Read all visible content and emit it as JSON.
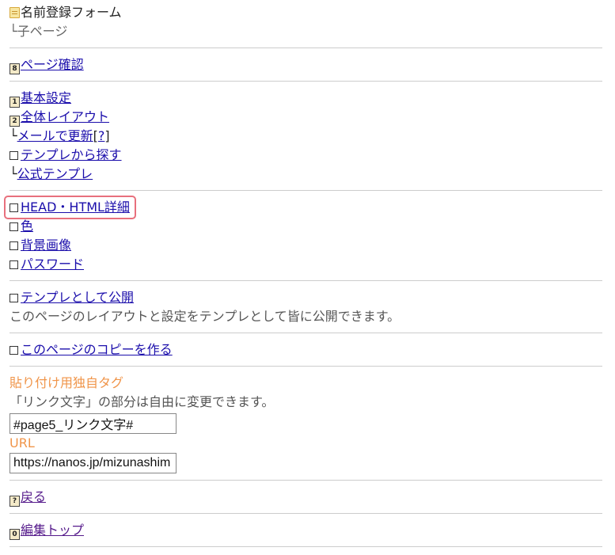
{
  "header": {
    "title": "名前登録フォーム",
    "child": "└子ページ"
  },
  "confirm": {
    "key": "8",
    "label": "ページ確認"
  },
  "settings": {
    "basic": {
      "key": "1",
      "label": "基本設定"
    },
    "layout": {
      "key": "2",
      "label": "全体レイアウト"
    },
    "mail_prefix": "└",
    "mail": "メールで更新",
    "help_open": "[",
    "help": "?",
    "help_close": "]",
    "template_search": "テンプレから探す",
    "official_prefix": "└",
    "official": "公式テンプレ"
  },
  "design": {
    "head_html": "HEAD・HTML詳細",
    "color": "色",
    "background": "背景画像",
    "password": "パスワード"
  },
  "publish": {
    "link": "テンプレとして公開",
    "desc": "このページのレイアウトと設定をテンプレとして皆に公開できます。"
  },
  "copy": {
    "link": "このページのコピーを作る"
  },
  "tag": {
    "heading": "貼り付け用独自タグ",
    "desc": "「リンク文字」の部分は自由に変更できます。",
    "value": "#page5_リンク文字#",
    "url_label": "URL",
    "url_value": "https://nanos.jp/mizunashim"
  },
  "back": {
    "key": "?",
    "label": "戻る"
  },
  "top": {
    "key": "0",
    "label": "編集トップ"
  }
}
